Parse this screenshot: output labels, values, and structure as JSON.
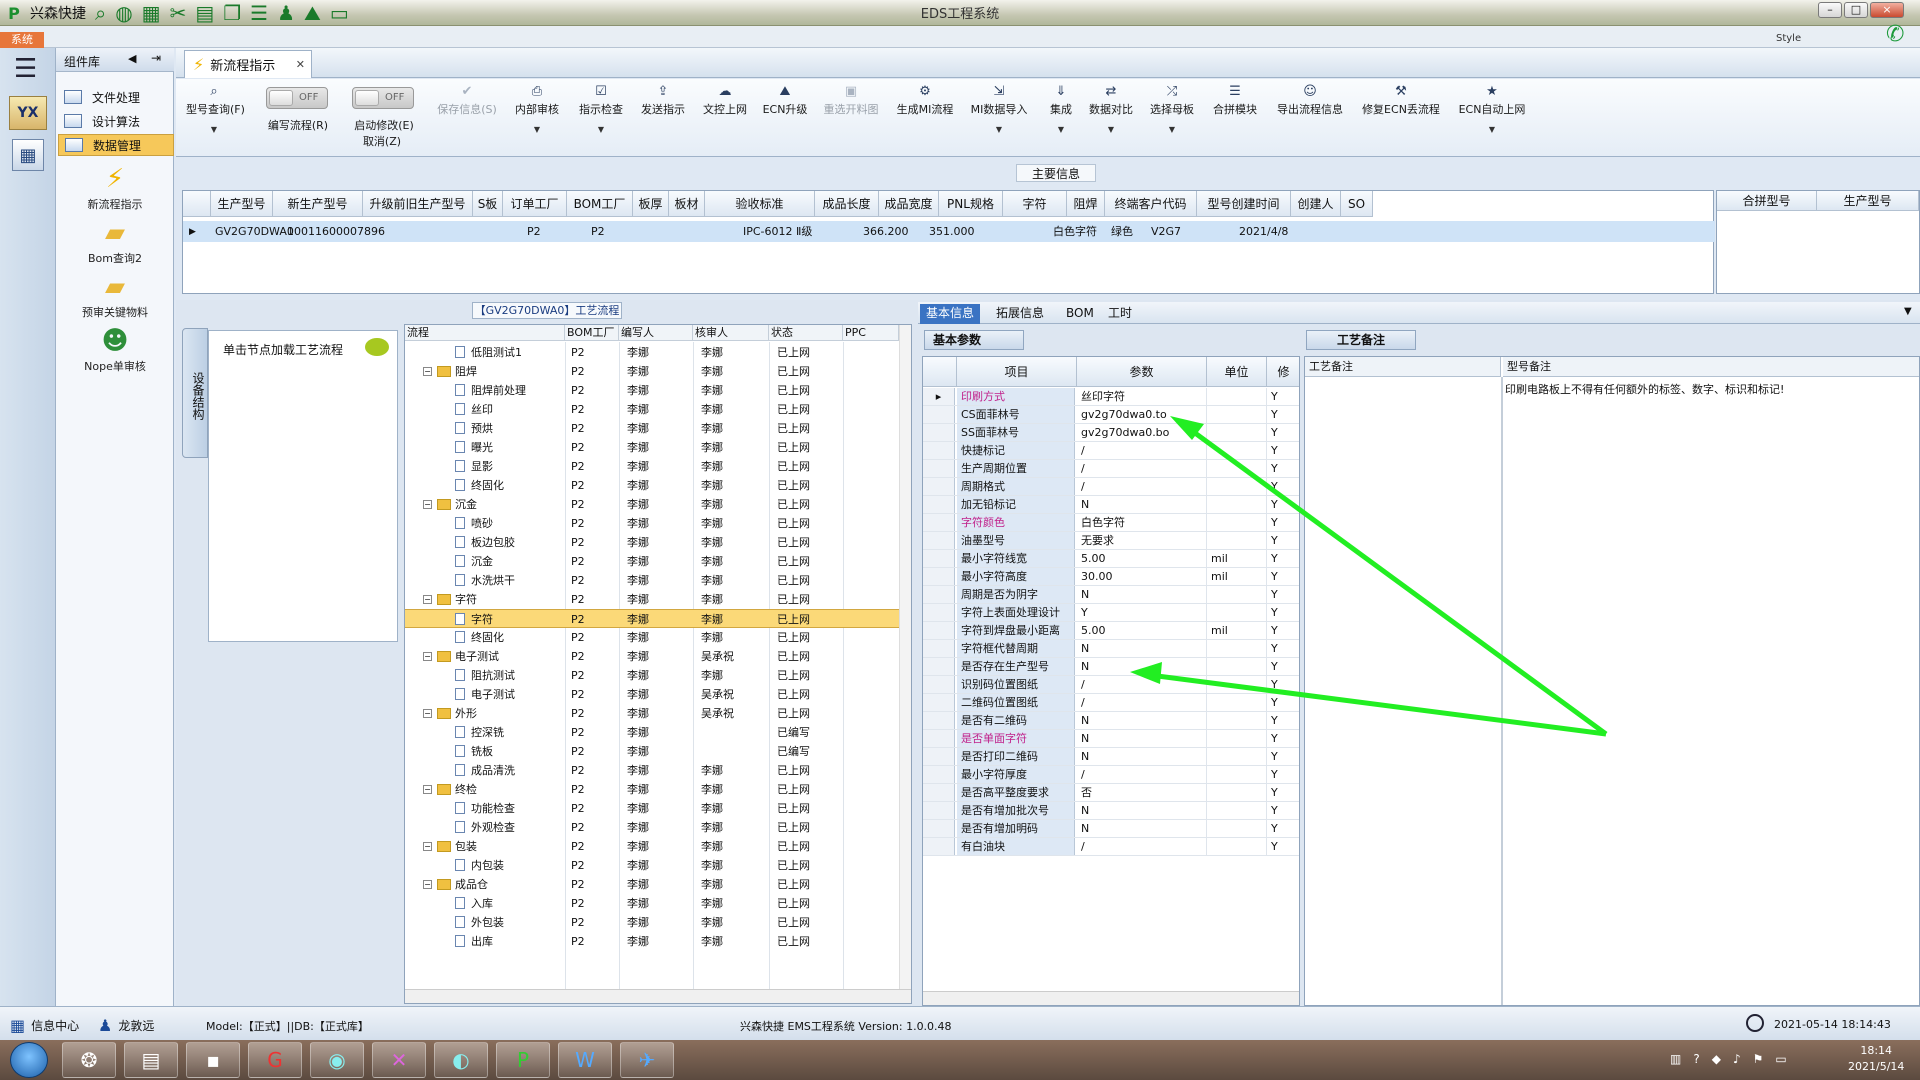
{
  "titlebar": {
    "app_name": "兴森快捷",
    "window_title": "EDS工程系统",
    "minimize": "–",
    "maximize": "□",
    "close": "×"
  },
  "menu": {
    "system_tab": "系统",
    "style_label": "Style"
  },
  "component_panel": {
    "title": "组件库",
    "items": [
      "文件处理",
      "设计算法",
      "数据管理"
    ],
    "tools": [
      "新流程指示",
      "Bom查询2",
      "预审关键物料",
      "Nope单审核"
    ]
  },
  "doc_tab": {
    "label": "新流程指示"
  },
  "ribbon": {
    "buttons": [
      {
        "label": "型号查询(F)",
        "icon": "search-icon"
      },
      {
        "label": "编写流程(R)",
        "icon": "toggle-icon"
      },
      {
        "label": "启动修改(E)",
        "icon": "toggle-icon"
      },
      {
        "label": "取消(Z)",
        "icon": ""
      },
      {
        "label": "保存信息(S)",
        "icon": "check-icon"
      },
      {
        "label": "内部审核",
        "icon": "print-icon"
      },
      {
        "label": "指示检查",
        "icon": "checkbox-icon"
      },
      {
        "label": "发送指示",
        "icon": "upload-icon"
      },
      {
        "label": "文控上网",
        "icon": "cloud-icon"
      },
      {
        "label": "ECN升级",
        "icon": "mountain-icon"
      },
      {
        "label": "重选开料图",
        "icon": "image-icon"
      },
      {
        "label": "生成MI流程",
        "icon": "cogs-icon"
      },
      {
        "label": "MI数据导入",
        "icon": "import-icon"
      },
      {
        "label": "集成",
        "icon": "download-icon"
      },
      {
        "label": "数据对比",
        "icon": "compare-icon"
      },
      {
        "label": "选择母板",
        "icon": "shuffle-icon"
      },
      {
        "label": "合拼模块",
        "icon": "list-icon"
      },
      {
        "label": "导出流程信息",
        "icon": "smile-icon"
      },
      {
        "label": "修复ECN丢流程",
        "icon": "wrench-icon"
      },
      {
        "label": "ECN自动上网",
        "icon": "star-icon"
      }
    ],
    "toggle_off": "OFF"
  },
  "main_info": {
    "label": "主要信息",
    "headers": [
      "生产型号",
      "新生产型号",
      "升级前旧生产型号",
      "S板",
      "订单工厂",
      "BOM工厂",
      "板厚",
      "板材",
      "验收标准",
      "成品长度",
      "成品宽度",
      "PNL规格",
      "字符",
      "阻焊",
      "终端客户代码",
      "型号创建时间",
      "创建人",
      "SO"
    ],
    "row": [
      "GV2G70DWA0",
      "10011600007896",
      "",
      "",
      "P2",
      "P2",
      "",
      "",
      "IPC-6012 Ⅱ级",
      "366.200",
      "351.000",
      "",
      "白色字符",
      "绿色",
      "V2G7",
      "2021/4/8",
      "",
      ""
    ],
    "right_headers": [
      "合拼型号",
      "生产型号"
    ]
  },
  "section_tab": "设备结构",
  "hint": {
    "text": "单击节点加载工艺流程"
  },
  "process": {
    "title": "【GV2G70DWA0】工艺流程",
    "headers": [
      "流程",
      "BOM工厂",
      "编写人",
      "核审人",
      "状态",
      "PPC"
    ],
    "rows": [
      {
        "name": "低阻测试1",
        "level": 2,
        "type": "doc",
        "bom": "P2",
        "writer": "李娜",
        "reviewer": "李娜",
        "status": "已上网"
      },
      {
        "name": "阻焊",
        "level": 1,
        "type": "folder",
        "bom": "P2",
        "writer": "李娜",
        "reviewer": "李娜",
        "status": "已上网"
      },
      {
        "name": "阻焊前处理",
        "level": 2,
        "type": "doc",
        "bom": "P2",
        "writer": "李娜",
        "reviewer": "李娜",
        "status": "已上网"
      },
      {
        "name": "丝印",
        "level": 2,
        "type": "doc",
        "bom": "P2",
        "writer": "李娜",
        "reviewer": "李娜",
        "status": "已上网"
      },
      {
        "name": "预烘",
        "level": 2,
        "type": "doc",
        "bom": "P2",
        "writer": "李娜",
        "reviewer": "李娜",
        "status": "已上网"
      },
      {
        "name": "曝光",
        "level": 2,
        "type": "doc",
        "bom": "P2",
        "writer": "李娜",
        "reviewer": "李娜",
        "status": "已上网"
      },
      {
        "name": "显影",
        "level": 2,
        "type": "doc",
        "bom": "P2",
        "writer": "李娜",
        "reviewer": "李娜",
        "status": "已上网"
      },
      {
        "name": "终固化",
        "level": 2,
        "type": "doc",
        "bom": "P2",
        "writer": "李娜",
        "reviewer": "李娜",
        "status": "已上网"
      },
      {
        "name": "沉金",
        "level": 1,
        "type": "folder",
        "bom": "P2",
        "writer": "李娜",
        "reviewer": "李娜",
        "status": "已上网"
      },
      {
        "name": "喷砂",
        "level": 2,
        "type": "doc",
        "bom": "P2",
        "writer": "李娜",
        "reviewer": "李娜",
        "status": "已上网"
      },
      {
        "name": "板边包胶",
        "level": 2,
        "type": "doc",
        "bom": "P2",
        "writer": "李娜",
        "reviewer": "李娜",
        "status": "已上网"
      },
      {
        "name": "沉金",
        "level": 2,
        "type": "doc",
        "bom": "P2",
        "writer": "李娜",
        "reviewer": "李娜",
        "status": "已上网"
      },
      {
        "name": "水洗烘干",
        "level": 2,
        "type": "doc",
        "bom": "P2",
        "writer": "李娜",
        "reviewer": "李娜",
        "status": "已上网"
      },
      {
        "name": "字符",
        "level": 1,
        "type": "folder",
        "bom": "P2",
        "writer": "李娜",
        "reviewer": "李娜",
        "status": "已上网"
      },
      {
        "name": "字符",
        "level": 2,
        "type": "doc",
        "bom": "P2",
        "writer": "李娜",
        "reviewer": "李娜",
        "status": "已上网",
        "selected": true
      },
      {
        "name": "终固化",
        "level": 2,
        "type": "doc",
        "bom": "P2",
        "writer": "李娜",
        "reviewer": "李娜",
        "status": "已上网"
      },
      {
        "name": "电子测试",
        "level": 1,
        "type": "folder",
        "bom": "P2",
        "writer": "李娜",
        "reviewer": "吴承祝",
        "status": "已上网"
      },
      {
        "name": "阻抗测试",
        "level": 2,
        "type": "doc",
        "bom": "P2",
        "writer": "李娜",
        "reviewer": "李娜",
        "status": "已上网"
      },
      {
        "name": "电子测试",
        "level": 2,
        "type": "doc",
        "bom": "P2",
        "writer": "李娜",
        "reviewer": "吴承祝",
        "status": "已上网"
      },
      {
        "name": "外形",
        "level": 1,
        "type": "folder",
        "bom": "P2",
        "writer": "李娜",
        "reviewer": "吴承祝",
        "status": "已上网"
      },
      {
        "name": "控深铣",
        "level": 2,
        "type": "doc",
        "bom": "P2",
        "writer": "李娜",
        "reviewer": "",
        "status": "已编写"
      },
      {
        "name": "铣板",
        "level": 2,
        "type": "doc",
        "bom": "P2",
        "writer": "李娜",
        "reviewer": "",
        "status": "已编写"
      },
      {
        "name": "成品清洗",
        "level": 2,
        "type": "doc",
        "bom": "P2",
        "writer": "李娜",
        "reviewer": "李娜",
        "status": "已上网"
      },
      {
        "name": "终检",
        "level": 1,
        "type": "folder",
        "bom": "P2",
        "writer": "李娜",
        "reviewer": "李娜",
        "status": "已上网"
      },
      {
        "name": "功能检查",
        "level": 2,
        "type": "doc",
        "bom": "P2",
        "writer": "李娜",
        "reviewer": "李娜",
        "status": "已上网"
      },
      {
        "name": "外观检查",
        "level": 2,
        "type": "doc",
        "bom": "P2",
        "writer": "李娜",
        "reviewer": "李娜",
        "status": "已上网"
      },
      {
        "name": "包装",
        "level": 1,
        "type": "folder",
        "bom": "P2",
        "writer": "李娜",
        "reviewer": "李娜",
        "status": "已上网"
      },
      {
        "name": "内包装",
        "level": 2,
        "type": "doc",
        "bom": "P2",
        "writer": "李娜",
        "reviewer": "李娜",
        "status": "已上网"
      },
      {
        "name": "成品仓",
        "level": 1,
        "type": "folder",
        "bom": "P2",
        "writer": "李娜",
        "reviewer": "李娜",
        "status": "已上网"
      },
      {
        "name": "入库",
        "level": 2,
        "type": "doc",
        "bom": "P2",
        "writer": "李娜",
        "reviewer": "李娜",
        "status": "已上网"
      },
      {
        "name": "外包装",
        "level": 2,
        "type": "doc",
        "bom": "P2",
        "writer": "李娜",
        "reviewer": "李娜",
        "status": "已上网"
      },
      {
        "name": "出库",
        "level": 2,
        "type": "doc",
        "bom": "P2",
        "writer": "李娜",
        "reviewer": "李娜",
        "status": "已上网"
      }
    ]
  },
  "detail_tabs": [
    "基本信息",
    "拓展信息",
    "BOM",
    "工时"
  ],
  "basic_params": {
    "label": "基本参数",
    "headers": [
      "项目",
      "参数",
      "单位",
      "修"
    ],
    "rows": [
      {
        "item": "印刷方式",
        "value": "丝印字符",
        "unit": "",
        "edit": "Y",
        "highlight": true
      },
      {
        "item": "CS面菲林号",
        "value": "gv2g70dwa0.to",
        "unit": "",
        "edit": "Y"
      },
      {
        "item": "SS面菲林号",
        "value": "gv2g70dwa0.bo",
        "unit": "",
        "edit": "Y"
      },
      {
        "item": "快捷标记",
        "value": "/",
        "unit": "",
        "edit": "Y"
      },
      {
        "item": "生产周期位置",
        "value": "/",
        "unit": "",
        "edit": "Y"
      },
      {
        "item": "周期格式",
        "value": "/",
        "unit": "",
        "edit": "Y"
      },
      {
        "item": "加无铅标记",
        "value": "N",
        "unit": "",
        "edit": "Y"
      },
      {
        "item": "字符颜色",
        "value": "白色字符",
        "unit": "",
        "edit": "Y",
        "highlight": true
      },
      {
        "item": "油墨型号",
        "value": "无要求",
        "unit": "",
        "edit": "Y"
      },
      {
        "item": "最小字符线宽",
        "value": "5.00",
        "unit": "mil",
        "edit": "Y"
      },
      {
        "item": "最小字符高度",
        "value": "30.00",
        "unit": "mil",
        "edit": "Y"
      },
      {
        "item": "周期是否为阴字",
        "value": "N",
        "unit": "",
        "edit": "Y"
      },
      {
        "item": "字符上表面处理设计",
        "value": "Y",
        "unit": "",
        "edit": "Y"
      },
      {
        "item": "字符到焊盘最小距离",
        "value": "5.00",
        "unit": "mil",
        "edit": "Y"
      },
      {
        "item": "字符框代替周期",
        "value": "N",
        "unit": "",
        "edit": "Y"
      },
      {
        "item": "是否存在生产型号",
        "value": "N",
        "unit": "",
        "edit": "Y"
      },
      {
        "item": "识别码位置图纸",
        "value": "/",
        "unit": "",
        "edit": "Y"
      },
      {
        "item": "二维码位置图纸",
        "value": "/",
        "unit": "",
        "edit": "Y"
      },
      {
        "item": "是否有二维码",
        "value": "N",
        "unit": "",
        "edit": "Y"
      },
      {
        "item": "是否单面字符",
        "value": "N",
        "unit": "",
        "edit": "Y",
        "highlight": true
      },
      {
        "item": "是否打印二维码",
        "value": "N",
        "unit": "",
        "edit": "Y"
      },
      {
        "item": "最小字符厚度",
        "value": "/",
        "unit": "",
        "edit": "Y"
      },
      {
        "item": "是否高平整度要求",
        "value": "否",
        "unit": "",
        "edit": "Y"
      },
      {
        "item": "是否有增加批次号",
        "value": "N",
        "unit": "",
        "edit": "Y"
      },
      {
        "item": "是否有增加明码",
        "value": "N",
        "unit": "",
        "edit": "Y"
      },
      {
        "item": "有白油块",
        "value": "/",
        "unit": "",
        "edit": "Y"
      }
    ]
  },
  "craft_notes": {
    "tab": "工艺备注",
    "col1": "工艺备注",
    "col2": "型号备注",
    "text": "印刷电路板上不得有任何额外的标签、数字、标识和标记!"
  },
  "status_bar": {
    "info_center": "信息中心",
    "user": "龙敦远",
    "model": "Model:【正式】||DB:【正式库】",
    "version": "兴森快捷 EMS工程系统 Version: 1.0.0.48",
    "datetime": "2021-05-14 18:14:43"
  },
  "taskbar": {
    "time": "18:14",
    "date": "2021/5/14"
  },
  "annotation_color": "#22ee22"
}
